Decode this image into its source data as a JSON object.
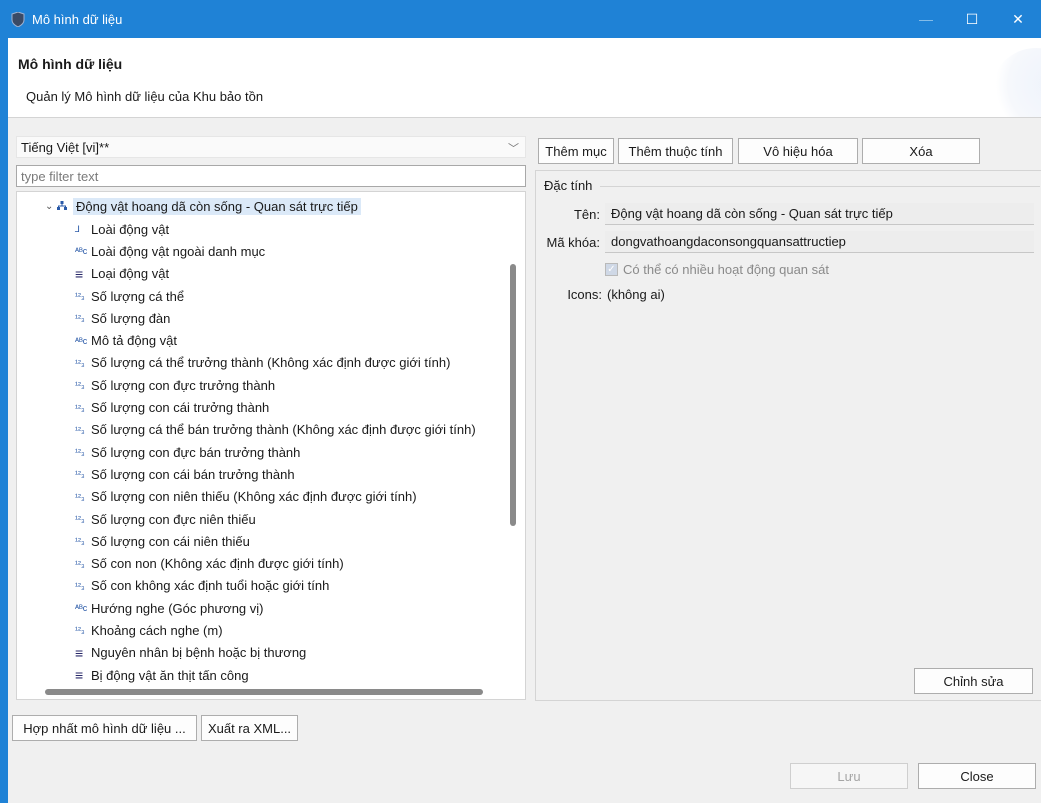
{
  "window": {
    "title": "Mô hình dữ liệu",
    "min_label": "—",
    "max_label": "☐",
    "close_label": "✕"
  },
  "header": {
    "title": "Mô hình dữ liệu",
    "subtitle": "Quản lý Mô hình dữ liệu của Khu bảo tồn"
  },
  "left": {
    "language": "Tiếng Việt [vi]**",
    "filter_placeholder": "type filter text",
    "tree_root": "Động vật hoang dã còn sống - Quan sát trực tiếp",
    "tree_items": [
      {
        "icon": "tree-icon",
        "glyph": "⅃",
        "label": "Loài động vật"
      },
      {
        "icon": "text-icon",
        "glyph": "ᴬᴮc",
        "label": "Loài động vật ngoài danh mục"
      },
      {
        "icon": "list-icon",
        "glyph": "≡",
        "label": "Loại động vật"
      },
      {
        "icon": "number-icon",
        "glyph": "¹²₃",
        "label": "Số lượng cá thể"
      },
      {
        "icon": "number-icon",
        "glyph": "¹²₃",
        "label": "Số lượng đàn"
      },
      {
        "icon": "text-icon",
        "glyph": "ᴬᴮc",
        "label": "Mô tả động vật"
      },
      {
        "icon": "number-icon",
        "glyph": "¹²₃",
        "label": "Số lượng cá thể trưởng thành (Không xác định được giới tính)"
      },
      {
        "icon": "number-icon",
        "glyph": "¹²₃",
        "label": "Số lượng con đực trưởng thành"
      },
      {
        "icon": "number-icon",
        "glyph": "¹²₃",
        "label": "Số lượng con cái trưởng thành"
      },
      {
        "icon": "number-icon",
        "glyph": "¹²₃",
        "label": "Số lượng cá thể bán trưởng thành (Không xác định được giới tính)"
      },
      {
        "icon": "number-icon",
        "glyph": "¹²₃",
        "label": "Số lượng con đực bán trưởng thành"
      },
      {
        "icon": "number-icon",
        "glyph": "¹²₃",
        "label": "Số lượng con cái bán trưởng thành"
      },
      {
        "icon": "number-icon",
        "glyph": "¹²₃",
        "label": "Số lượng con niên thiếu (Không xác định được giới tính)"
      },
      {
        "icon": "number-icon",
        "glyph": "¹²₃",
        "label": "Số lượng con đực niên thiếu"
      },
      {
        "icon": "number-icon",
        "glyph": "¹²₃",
        "label": "Số lượng con cái niên thiếu"
      },
      {
        "icon": "number-icon",
        "glyph": "¹²₃",
        "label": "Số con non (Không xác định được giới tính)"
      },
      {
        "icon": "number-icon",
        "glyph": "¹²₃",
        "label": "Số con không xác định tuổi hoặc giới tính"
      },
      {
        "icon": "text-icon",
        "glyph": "ᴬᴮc",
        "label": "Hướng nghe (Góc phương vị)"
      },
      {
        "icon": "number-icon",
        "glyph": "¹²₃",
        "label": "Khoảng cách nghe (m)"
      },
      {
        "icon": "list-icon",
        "glyph": "≡",
        "label": "Nguyên nhân bị bệnh hoặc bị thương"
      },
      {
        "icon": "list-icon",
        "glyph": "≡",
        "label": "Bị động vật ăn thịt tấn công"
      }
    ],
    "merge_button": "Hợp nhất mô hình dữ liệu ...",
    "export_button": "Xuất ra XML..."
  },
  "toolbar": {
    "add_category": "Thêm mục",
    "add_attribute": "Thêm thuộc tính",
    "disable": "Vô hiệu hóa",
    "delete": "Xóa"
  },
  "properties": {
    "legend": "Đặc tính",
    "name_label": "Tên:",
    "name_value": "Động vật hoang dã còn sống - Quan sát trực tiếp",
    "key_label": "Mã khóa:",
    "key_value": "dongvathoangdaconsongquansattructiep",
    "multi_obs_label": "Có thể có nhiều hoạt động quan sát",
    "multi_obs_checked": true,
    "icons_label": "Icons:",
    "icons_value": "(không ai)",
    "edit_button": "Chỉnh sửa"
  },
  "footer": {
    "save_button": "Lưu",
    "close_button": "Close"
  },
  "colors": {
    "titlebar": "#1f82d6",
    "selection": "#dbe9f8"
  }
}
